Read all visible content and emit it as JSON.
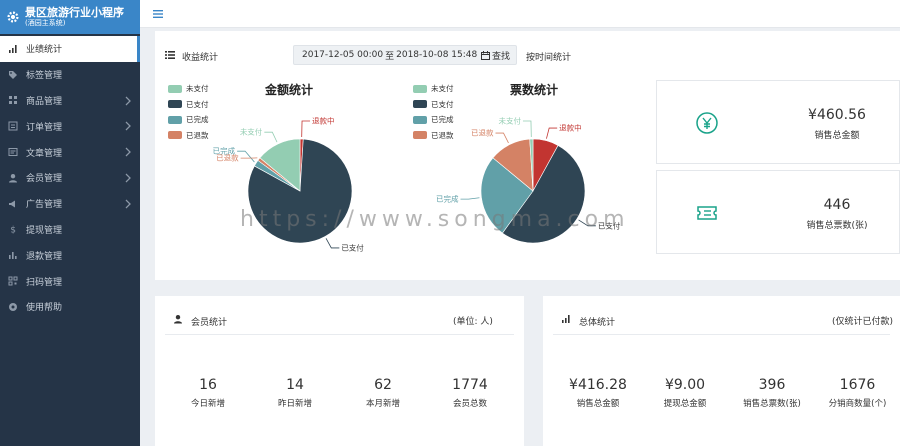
{
  "brand": {
    "title": "景区旅游行业小程序",
    "subtitle": "(酒园主系统)",
    "icon": "gear-icon"
  },
  "sidebar": {
    "items": [
      {
        "label": "业绩统计",
        "icon": "bar-chart-icon",
        "active": true,
        "has_children": false
      },
      {
        "label": "标签管理",
        "icon": "tag-icon",
        "active": false,
        "has_children": false
      },
      {
        "label": "商品管理",
        "icon": "grid-icon",
        "active": false,
        "has_children": true
      },
      {
        "label": "订单管理",
        "icon": "list-icon",
        "active": false,
        "has_children": true
      },
      {
        "label": "文章管理",
        "icon": "document-icon",
        "active": false,
        "has_children": true
      },
      {
        "label": "会员管理",
        "icon": "user-icon",
        "active": false,
        "has_children": true
      },
      {
        "label": "广告管理",
        "icon": "megaphone-icon",
        "active": false,
        "has_children": true
      },
      {
        "label": "提现管理",
        "icon": "dollar-icon",
        "active": false,
        "has_children": false
      },
      {
        "label": "退款管理",
        "icon": "refund-icon",
        "active": false,
        "has_children": false
      },
      {
        "label": "扫码管理",
        "icon": "qrcode-icon",
        "active": false,
        "has_children": false
      },
      {
        "label": "使用帮助",
        "icon": "help-icon",
        "active": false,
        "has_children": false
      }
    ]
  },
  "income": {
    "title": "收益统计",
    "date_start": "2017-12-05 00:00",
    "date_sep": "至",
    "date_end": "2018-10-08 15:48",
    "search_label": "查找",
    "by_time_label": "按时间统计"
  },
  "colors": {
    "unpaid": "#93cdb2",
    "paid": "#2f4554",
    "done": "#61a0a8",
    "refunded": "#d48265",
    "refunding": "#c23531",
    "accent": "#3a86c8",
    "money_icon": "#1aa38a"
  },
  "chart_data": [
    {
      "type": "pie",
      "title": "金额统计",
      "legend": [
        "未支付",
        "已支付",
        "已完成",
        "已退款"
      ],
      "slices": [
        {
          "name": "退款中",
          "value": 1
        },
        {
          "name": "已支付",
          "value": 82
        },
        {
          "name": "已完成",
          "value": 2
        },
        {
          "name": "已退款",
          "value": 1
        },
        {
          "name": "未支付",
          "value": 14
        }
      ]
    },
    {
      "type": "pie",
      "title": "票数统计",
      "legend": [
        "未支付",
        "已支付",
        "已完成",
        "已退款"
      ],
      "slices": [
        {
          "name": "退款中",
          "value": 8
        },
        {
          "name": "已支付",
          "value": 52
        },
        {
          "name": "已完成",
          "value": 26
        },
        {
          "name": "已退款",
          "value": 13
        },
        {
          "name": "未支付",
          "value": 1
        }
      ]
    }
  ],
  "sales": {
    "amount_value": "¥460.56",
    "amount_label": "销售总金额",
    "tickets_value": "446",
    "tickets_label": "销售总票数(张)"
  },
  "member": {
    "title": "会员统计",
    "unit": "(单位: 人)",
    "stats": [
      {
        "value": "16",
        "label": "今日新增"
      },
      {
        "value": "14",
        "label": "昨日新增"
      },
      {
        "value": "62",
        "label": "本月新增"
      },
      {
        "value": "1774",
        "label": "会员总数"
      }
    ]
  },
  "total": {
    "title": "总体统计",
    "note": "(仅统计已付款)",
    "stats": [
      {
        "value": "¥416.28",
        "label": "销售总金额"
      },
      {
        "value": "¥9.00",
        "label": "提现总金额"
      },
      {
        "value": "396",
        "label": "销售总票数(张)"
      },
      {
        "value": "1676",
        "label": "分销商数量(个)"
      }
    ]
  },
  "watermark": "https://www.songma.com"
}
